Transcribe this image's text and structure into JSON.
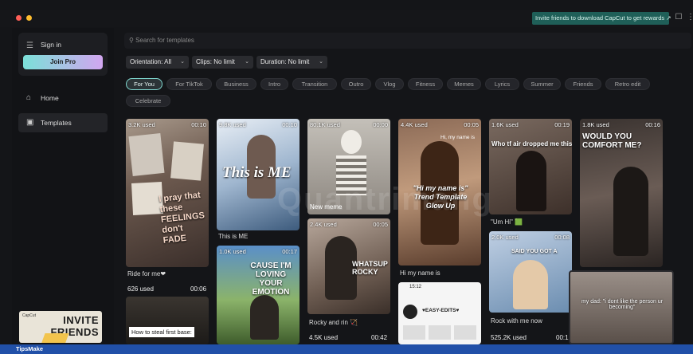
{
  "colors": {
    "accent": "#7fd7cf",
    "bg": "#141518",
    "invite_bg": "#1f5f58"
  },
  "topbar": {
    "invite_text": "Invite friends to download CapCut to get rewards ↗"
  },
  "sidebar": {
    "signin": "Sign in",
    "join_pro": "Join Pro",
    "home": "Home",
    "templates": "Templates",
    "promo": {
      "brand": "CapCut",
      "line1": "INVITE",
      "line2": "FRIENDS"
    }
  },
  "search": {
    "placeholder": "Search for templates"
  },
  "filters": [
    {
      "label": "Orientation: All"
    },
    {
      "label": "Clips: No limit"
    },
    {
      "label": "Duration: No limit"
    }
  ],
  "categories": [
    "For You",
    "For TikTok",
    "Business",
    "Intro",
    "Transition",
    "Outro",
    "Vlog",
    "Fitness",
    "Memes",
    "Lyrics",
    "Summer",
    "Friends",
    "Retro edit",
    "Celebrate"
  ],
  "selected_category": "For You",
  "cards": [
    {
      "used": "3.2K used",
      "dur": "00:10",
      "caption": "Ride for me❤",
      "overlay": "I pray that these FEELINGS don't FADE"
    },
    {
      "used": "626 used",
      "dur": "00:06",
      "caption": "How to steal first base:"
    },
    {
      "used": "9.8K used",
      "dur": "00:10",
      "caption": "This is ME",
      "overlay": "This is ME"
    },
    {
      "used": "1.0K used",
      "dur": "00:17",
      "overlay": "CAUSE I'M LOVING YOUR EMOTION"
    },
    {
      "used": "80.1K used",
      "dur": "00:00",
      "caption": "New meme"
    },
    {
      "used": "2.4K used",
      "dur": "00:05",
      "caption": "Rocky and rin 🏹",
      "overlay": "WHATSUP ROCKY"
    },
    {
      "used": "4.5K used",
      "dur": "00:42"
    },
    {
      "used": "4.4K used",
      "dur": "00:05",
      "caption": "Hi my name is",
      "overlay": "\"Hi my name is\" Trend Template Glow Up",
      "top": "Hi, my name is"
    },
    {
      "profile": "♥EASY-EDITS♥",
      "time": "15:12"
    },
    {
      "used": "1.6K used",
      "dur": "00:19",
      "caption": "\"Um Hi\" 🟩",
      "overlay": "Who tf air dropped me this"
    },
    {
      "used": "2.0K used",
      "dur": "00:08",
      "caption": "Rock with me now",
      "overlay": "SAID YOU GOT A"
    },
    {
      "used": "525.2K used",
      "dur": "00:1"
    },
    {
      "used": "1.8K used",
      "dur": "00:16",
      "overlay": "WOULD YOU COMFORT ME?"
    },
    {
      "overlay": "my dad: \"i dont like the person ur becoming\""
    }
  ],
  "bottombar": "TipsMake",
  "watermark": "Quantrimang"
}
